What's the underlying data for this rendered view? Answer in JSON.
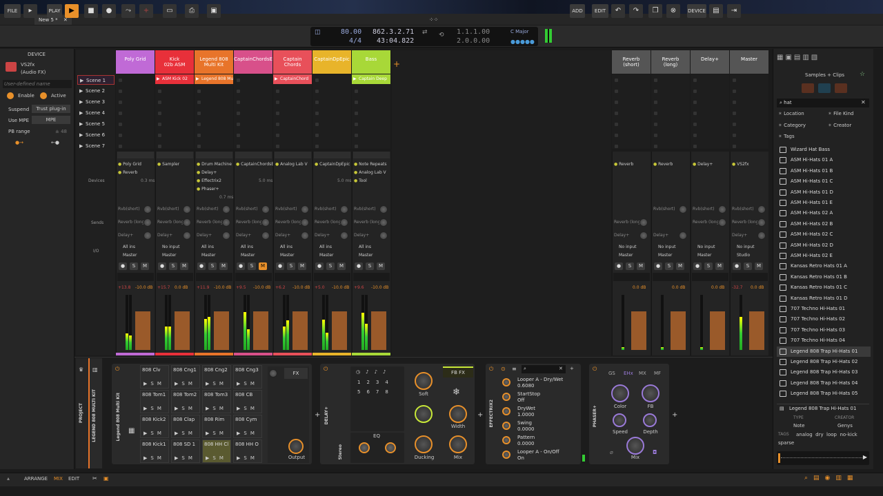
{
  "window": {
    "tab_title": "New 5 *"
  },
  "toolbar": {
    "file": "FILE",
    "play": "PLAY",
    "add": "ADD",
    "edit": "EDIT",
    "device": "DEVICE"
  },
  "transport": {
    "tempo": "80.00",
    "signature": "4/4",
    "position": "862.3.2.71",
    "time": "43:04.822",
    "loop_start": "1.1.1.00",
    "loop_len": "2.0.0.00",
    "key": "C Major"
  },
  "left_panel": {
    "header": "DEVICE",
    "plugin_name": "VS2fx",
    "plugin_type": "(Audio FX)",
    "user_defined": "User-defined name",
    "enable": "Enable",
    "active": "Active",
    "suspend_label": "Suspend",
    "suspend_value": "Trust plug-in",
    "use_mpe_label": "Use MPE",
    "use_mpe_value": "MPE",
    "pb_range_label": "PB range",
    "pb_range_value": "± 48"
  },
  "scenes": [
    "Scene 1",
    "Scene 2",
    "Scene 3",
    "Scene 4",
    "Scene 5",
    "Scene 6",
    "Scene 7"
  ],
  "tracks": [
    {
      "name": "Poly Grid",
      "color": "#c06ad6",
      "devices": [
        "Poly Grid",
        "Reverb"
      ],
      "dev_time": "0.3 ms",
      "input": "All ins",
      "output": "Master",
      "level": "+13.8",
      "vol": "-10.0 dB"
    },
    {
      "name": "Kick\n02b ASM",
      "color": "#e8303a",
      "clip": "ASM Kick 02",
      "devices": [
        "Sampler"
      ],
      "dev_time": "",
      "input": "No input",
      "output": "Master",
      "level": "+15.7",
      "vol": "0.0 dB"
    },
    {
      "name": "Legend 808\nMulti Kit",
      "color": "#e8742a",
      "clip": "Legend 808 Mul",
      "devices": [
        "Drum Machine",
        "Delay+",
        "Effectrix2",
        "Phaser+"
      ],
      "dev_time": "0.7 ms",
      "input": "All ins",
      "output": "Master",
      "level": "+11.9",
      "vol": "-10.0 dB"
    },
    {
      "name": "CaptainChordsE",
      "color": "#d8508a",
      "devices": [
        "CaptainChordsEp"
      ],
      "dev_time": "5.0 ms",
      "input": "All ins",
      "output": "Master",
      "level": "+9.5",
      "vol": "-10.0 dB"
    },
    {
      "name": "Captain\nChords",
      "color": "#e8505a",
      "clip": "CaptainChord",
      "devices": [
        "Analog Lab V"
      ],
      "dev_time": "",
      "input": "All ins",
      "output": "Master",
      "level": "+6.2",
      "vol": "-10.0 dB"
    },
    {
      "name": "CaptainDpEpic",
      "color": "#e8b42a",
      "devices": [
        "CaptainDpEpic"
      ],
      "dev_time": "5.0 ms",
      "input": "All ins",
      "output": "Master",
      "level": "+5.0",
      "vol": "-10.0 dB"
    },
    {
      "name": "Bass",
      "color": "#a8d838",
      "clip": "Captain Deep",
      "devices": [
        "Note Repeats",
        "Analog Lab V",
        "Tool"
      ],
      "dev_time": "",
      "input": "All ins",
      "output": "Master",
      "level": "+9.6",
      "vol": "-10.0 dB"
    }
  ],
  "fx_tracks": [
    {
      "name": "Reverb\n(short)",
      "devices": [
        "Reverb"
      ],
      "input": "No input",
      "output": "Master",
      "vol": "0.0 dB"
    },
    {
      "name": "Reverb\n(long)",
      "devices": [
        "Reverb"
      ],
      "input": "No input",
      "output": "Master",
      "vol": "0.0 dB"
    },
    {
      "name": "Delay+",
      "devices": [
        "Delay+"
      ],
      "input": "No input",
      "output": "Master",
      "vol": "0.0 dB"
    },
    {
      "name": "Master",
      "devices": [
        "VS2fx"
      ],
      "input": "No input",
      "output": "Studio",
      "level": "-32.7",
      "vol": "0.0 dB"
    }
  ],
  "mixer_labels": {
    "devices": "Devices",
    "sends": "Sends",
    "io": "I/O",
    "send1": "Rvb(short)",
    "send2": "Reverb (long)",
    "send3": "Delay+"
  },
  "browser": {
    "title": "Samples + Clips",
    "search": "hat",
    "filters": [
      "Location",
      "File Kind",
      "Category",
      "Creator",
      "Tags"
    ],
    "items": [
      "Wizard Hat Bass",
      "ASM Hi-Hats 01 A",
      "ASM Hi-Hats 01 B",
      "ASM Hi-Hats 01 C",
      "ASM Hi-Hats 01 D",
      "ASM Hi-Hats 01 E",
      "ASM Hi-Hats 02 A",
      "ASM Hi-Hats 02 B",
      "ASM Hi-Hats 02 C",
      "ASM Hi-Hats 02 D",
      "ASM Hi-Hats 02 E",
      "Kansas Retro Hats 01 A",
      "Kansas Retro Hats 01 B",
      "Kansas Retro Hats 01 C",
      "Kansas Retro Hats 01 D",
      "707 Techno Hi-Hats 01",
      "707 Techno Hi-Hats 02",
      "707 Techno Hi-Hats 03",
      "707 Techno Hi-Hats 04",
      "Legend 808 Trap Hi-Hats 01",
      "Legend 808 Trap Hi-Hats 02",
      "Legend 808 Trap Hi-Hats 03",
      "Legend 808 Trap Hi-Hats 04",
      "Legend 808 Trap Hi-Hats 05"
    ],
    "selected_index": 19,
    "preview": {
      "name": "Legend 808 Trap Hi-Hats 01",
      "type_label": "TYPE",
      "type": "Note",
      "creator_label": "CREATOR",
      "creator": "Genys",
      "tags_label": "TAGS",
      "tags": "analog  dry  loop  no-kick",
      "tags2": "sparse"
    }
  },
  "device_chain": {
    "project": "PROJECT",
    "track": "LEGEND 808 MULTI KIT",
    "drum": "Legend 808 Multi Kit",
    "delay": "DELAY+",
    "effectrix": "EFFECTRIX2",
    "phaser": "PHASER+",
    "pads": [
      "808 Clv",
      "808 Cng1",
      "808 Cng2",
      "808 Cng3",
      "808 Tom1",
      "808 Tom2",
      "808 Tom3",
      "808 CB",
      "808 Kick2",
      "808 Clap",
      "808 Rim",
      "808 Cym",
      "808 Kick1",
      "808 SD 1",
      "808 HH Cl",
      "808 HH O"
    ],
    "fx_label": "FX",
    "output_label": "Output",
    "stereo": "Stereo",
    "eq": "EQ",
    "fbfx": "FB FX",
    "soft": "Soft",
    "width": "Width",
    "ducking": "Ducking",
    "mix": "Mix",
    "params": [
      {
        "name": "Looper A - Dry/Wet",
        "value": "0.6080"
      },
      {
        "name": "StartStop",
        "value": "Off"
      },
      {
        "name": "DryWet",
        "value": "1.0000"
      },
      {
        "name": "Swing",
        "value": "0.0000"
      },
      {
        "name": "Pattern",
        "value": "0.0000"
      },
      {
        "name": "Looper A - On/Off",
        "value": "On"
      }
    ],
    "phaser_tabs": [
      "GS",
      "EHx",
      "MX",
      "MF"
    ],
    "color": "Color",
    "fb": "FB",
    "speed": "Speed",
    "depth": "Depth"
  },
  "status": {
    "arrange": "ARRANGE",
    "mix": "MIX",
    "edit": "EDIT"
  }
}
